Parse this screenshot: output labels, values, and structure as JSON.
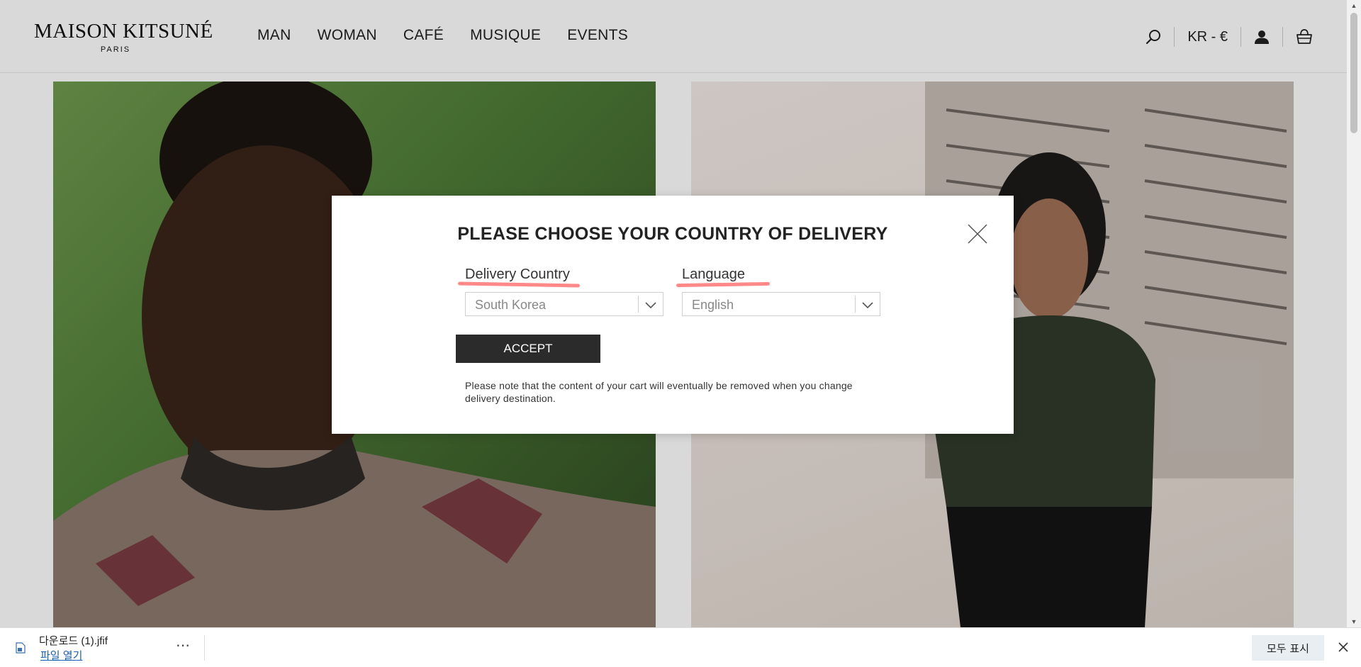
{
  "header": {
    "logo_main": "MAISON KITSUNÉ",
    "logo_sub": "PARIS",
    "nav": [
      "MAN",
      "WOMAN",
      "CAFÉ",
      "MUSIQUE",
      "EVENTS"
    ],
    "currency": "KR - €"
  },
  "modal": {
    "title": "PLEASE CHOOSE YOUR COUNTRY OF DELIVERY",
    "country_label": "Delivery Country",
    "country_value": "South Korea",
    "language_label": "Language",
    "language_value": "English",
    "accept_label": "ACCEPT",
    "note": "Please note that the content of your cart will eventually be removed when you change delivery destination."
  },
  "download_bar": {
    "filename": "다운로드 (1).jfif",
    "open_label": "파일 열기",
    "more_label": "⋯",
    "show_all_label": "모두 표시"
  },
  "colors": {
    "accent_underline": "#ff6b6b",
    "button_dark": "#2b2b2b",
    "link": "#1a5fb4"
  },
  "icons": {
    "header": [
      "search-icon",
      "account-icon",
      "cart-icon"
    ],
    "modal": [
      "close-icon",
      "chevron-down-icon"
    ],
    "download": [
      "file-icon",
      "close-icon"
    ]
  }
}
